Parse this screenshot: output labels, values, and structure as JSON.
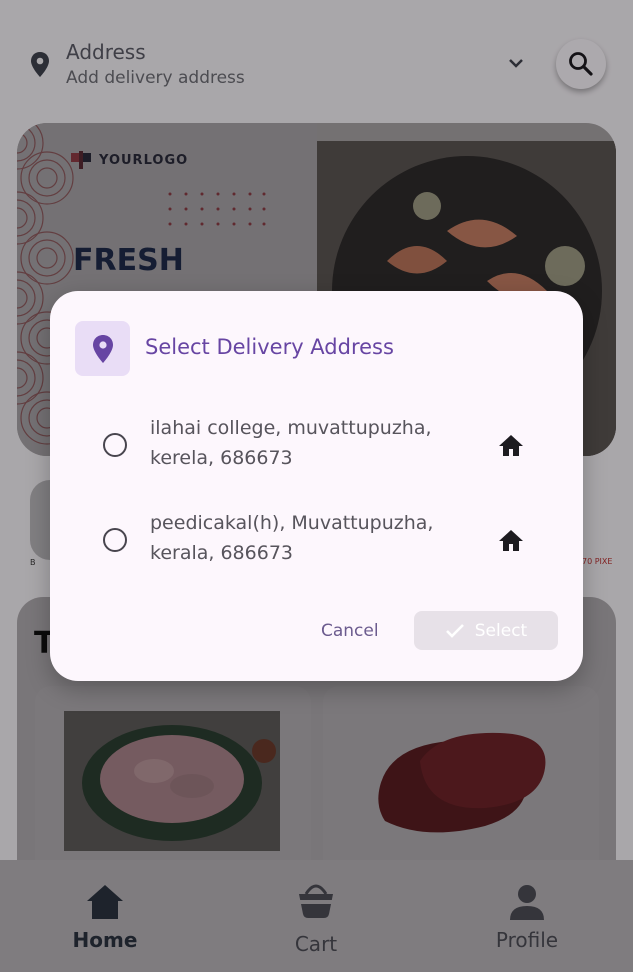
{
  "header": {
    "title": "Address",
    "subtitle": "Add delivery address"
  },
  "banner": {
    "logo_text": "YOURLOGO",
    "headline": "FRESH"
  },
  "strip": {
    "left_text": "B",
    "right_text": "70 PIXE"
  },
  "section": {
    "title_partial": "T"
  },
  "dialog": {
    "title": "Select Delivery Address",
    "options": [
      {
        "address": "ilahai college, muvattupuzha, kerela, 686673",
        "selected": false,
        "icon": "home-icon"
      },
      {
        "address": "peedicakal(h), Muvattupuzha, kerala, 686673",
        "selected": false,
        "icon": "home-icon"
      }
    ],
    "cancel_label": "Cancel",
    "select_label": "Select",
    "select_enabled": false
  },
  "bottom_nav": {
    "items": [
      {
        "label": "Home",
        "icon": "home-icon",
        "active": true
      },
      {
        "label": "Cart",
        "icon": "basket-icon",
        "active": false
      },
      {
        "label": "Profile",
        "icon": "person-icon",
        "active": false
      }
    ]
  },
  "colors": {
    "accent": "#6745a3",
    "dialog_bg": "#fdf7fd",
    "icon_tile": "#e9ddf6"
  }
}
